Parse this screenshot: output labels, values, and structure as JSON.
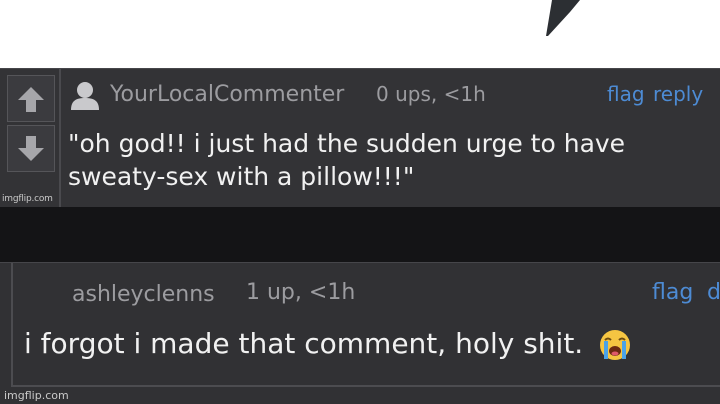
{
  "comment_1": {
    "username": "YourLocalCommenter",
    "meta": "0 ups, <1h",
    "flag_label": "flag",
    "reply_label": "reply",
    "text_line1": "\"oh god!! i just had the sudden urge to have",
    "text_line2": "sweaty-sex with a pillow!!!\"",
    "watermark": "imgflip.com"
  },
  "comment_2": {
    "username": "ashleyclenns",
    "meta": "1 up, <1h",
    "flag_label": "flag",
    "reply_label": "d",
    "text": "i forgot i made that comment, holy shit.",
    "emoji": "loudly-crying-face-icon",
    "watermark": "imgflip.com"
  },
  "colors": {
    "panel_bg": "#333336",
    "gap_bg": "#141416",
    "link_blue": "#4d8bd4",
    "meta_gray": "#9c9ca0",
    "text_white": "#f1f1f1"
  }
}
